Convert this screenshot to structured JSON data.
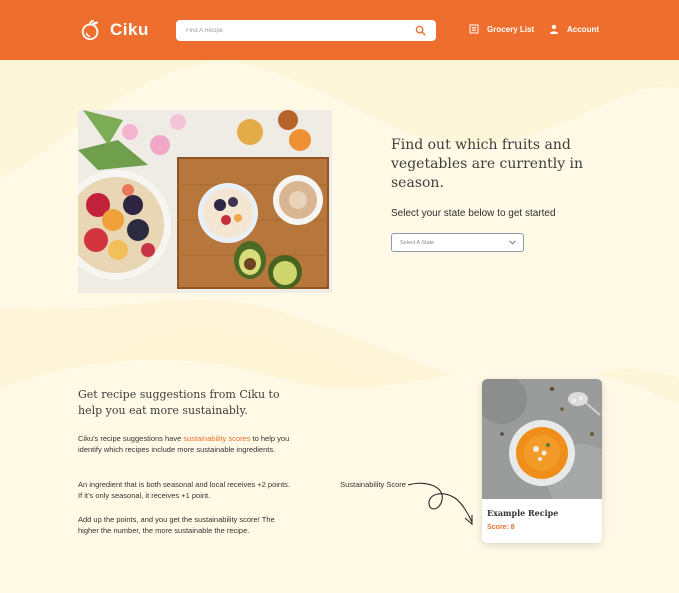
{
  "header": {
    "brand": "Ciku",
    "search_placeholder": "Find A Recipe",
    "nav": {
      "grocery": "Grocery List",
      "account": "Account"
    }
  },
  "season": {
    "title": "Find out which fruits and vegetables are currently in season.",
    "subtitle": "Select your state below to get started",
    "select_placeholder": "Select A State"
  },
  "suggestions": {
    "title": "Get recipe suggestions from Ciku to help you eat more sustainably.",
    "p1_before": "Ciku’s recipe suggestions have ",
    "p1_link": "sustainability scores",
    "p1_after": " to help you identify which recipes include more sustainable ingredients.",
    "p2": "An ingredient that is both seasonal and local receives +2 points. If it’s only seasonal, it receives +1 point.",
    "p3": "Add up the points, and you get the sustainability score! The higher the number, the more sustainable the recipe.",
    "score_label": "Sustainability Score"
  },
  "example_card": {
    "title": "Example Recipe",
    "score": "Score: 8"
  },
  "colors": {
    "brand": "#ee6f2d",
    "background": "#fef6d9",
    "wave": "#fef9e6"
  },
  "icons": [
    "orange-logo-icon",
    "search-icon",
    "list-icon",
    "user-icon",
    "chevron-down-icon",
    "curly-arrow-icon"
  ]
}
